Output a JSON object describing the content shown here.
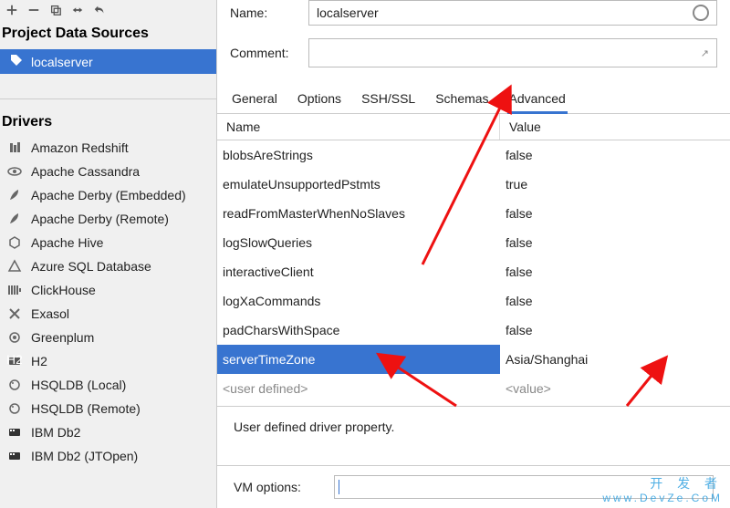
{
  "sidebar": {
    "projectDataSourcesTitle": "Project Data Sources",
    "datasourceName": "localserver",
    "driversTitle": "Drivers",
    "drivers": [
      {
        "icon": "redshift",
        "label": "Amazon Redshift"
      },
      {
        "icon": "eye",
        "label": "Apache Cassandra"
      },
      {
        "icon": "feather",
        "label": "Apache Derby (Embedded)"
      },
      {
        "icon": "feather",
        "label": "Apache Derby (Remote)"
      },
      {
        "icon": "hive",
        "label": "Apache Hive"
      },
      {
        "icon": "azure",
        "label": "Azure SQL Database"
      },
      {
        "icon": "clickhouse",
        "label": "ClickHouse"
      },
      {
        "icon": "exasol",
        "label": "Exasol"
      },
      {
        "icon": "greenplum",
        "label": "Greenplum"
      },
      {
        "icon": "h2",
        "label": "H2"
      },
      {
        "icon": "hsql",
        "label": "HSQLDB (Local)"
      },
      {
        "icon": "hsql",
        "label": "HSQLDB (Remote)"
      },
      {
        "icon": "db2",
        "label": "IBM Db2"
      },
      {
        "icon": "db2",
        "label": "IBM Db2 (JTOpen)"
      }
    ]
  },
  "form": {
    "nameLabel": "Name:",
    "nameValue": "localserver",
    "commentLabel": "Comment:"
  },
  "tabs": [
    "General",
    "Options",
    "SSH/SSL",
    "Schemas",
    "Advanced"
  ],
  "activeTab": "Advanced",
  "table": {
    "headers": {
      "name": "Name",
      "value": "Value"
    },
    "rows": [
      {
        "name": "blobsAreStrings",
        "value": "false"
      },
      {
        "name": "emulateUnsupportedPstmts",
        "value": "true"
      },
      {
        "name": "readFromMasterWhenNoSlaves",
        "value": "false"
      },
      {
        "name": "logSlowQueries",
        "value": "false"
      },
      {
        "name": "interactiveClient",
        "value": "false"
      },
      {
        "name": "logXaCommands",
        "value": "false"
      },
      {
        "name": "padCharsWithSpace",
        "value": "false"
      },
      {
        "name": "serverTimeZone",
        "value": "Asia/Shanghai",
        "selected": true
      },
      {
        "name": "<user defined>",
        "value": "<value>",
        "userDefined": true
      }
    ]
  },
  "description": "User defined driver property.",
  "vmOptions": {
    "label": "VM options:"
  },
  "watermark": {
    "line1": "开 发 者",
    "line2": "www.DevZe.CoM"
  }
}
